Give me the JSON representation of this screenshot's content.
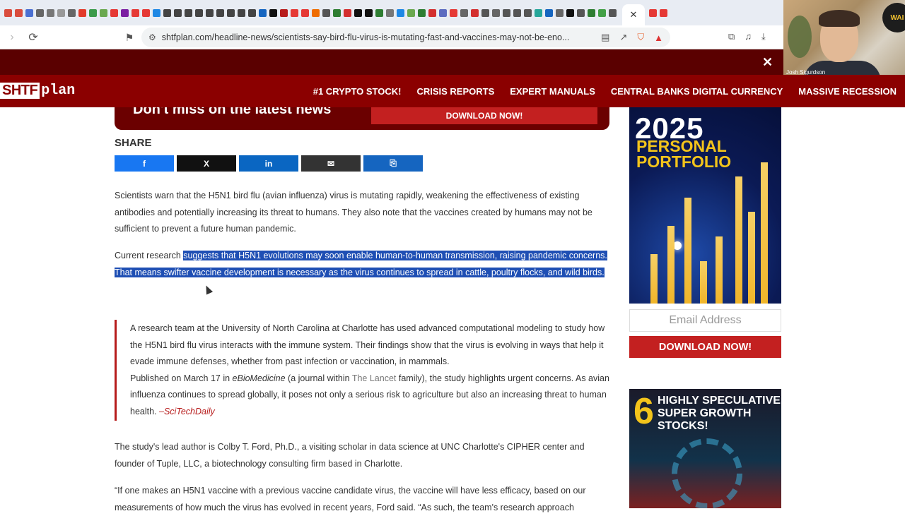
{
  "browser": {
    "url": "shtfplan.com/headline-news/scientists-say-bird-flu-virus-is-mutating-fast-and-vaccines-may-not-be-eno...",
    "tab_favicon_colors": [
      "#d94c3d",
      "#d94c3d",
      "#4a6fd1",
      "#666",
      "#777",
      "#999",
      "#666",
      "#e23b2a",
      "#3b9b4a",
      "#6aa84f",
      "#e53935",
      "#7b1fa2",
      "#e53935",
      "#e53935",
      "#1e88e5",
      "#444",
      "#444",
      "#444",
      "#444",
      "#444",
      "#444",
      "#444",
      "#444",
      "#444",
      "#1565c0",
      "#111",
      "#b71c1c",
      "#e53935",
      "#e53935",
      "#ef6c00",
      "#555",
      "#2e7d32",
      "#d32f2f",
      "#111",
      "#111",
      "#2e7d32",
      "#777",
      "#1e88e5",
      "#6aa84f",
      "#2e7d32",
      "#d32f2f",
      "#5c6bc0",
      "#e53935",
      "#666",
      "#d32f2f",
      "#555",
      "#666",
      "#555",
      "#555",
      "#555",
      "#26a69a",
      "#1565c0",
      "#666",
      "#111",
      "#555",
      "#2e7d32",
      "#43a047",
      "#555",
      "#e53935",
      "#e53935"
    ]
  },
  "webcam": {
    "name": "Josh Sigurdson",
    "logo_text": "WAI"
  },
  "site": {
    "logo_shtf": "SHTF",
    "logo_plan": "plan",
    "nav": [
      "#1 CRYPTO STOCK!",
      "CRISIS REPORTS",
      "EXPERT MANUALS",
      "CENTRAL BANKS DIGITAL CURRENCY",
      "MASSIVE RECESSION"
    ]
  },
  "banner": {
    "text": "Don't miss on the latest news",
    "button": "DOWNLOAD NOW!"
  },
  "share": {
    "label": "SHARE",
    "buttons": [
      {
        "name": "facebook",
        "glyph": "f",
        "color": "#1877f2"
      },
      {
        "name": "x",
        "glyph": "X",
        "color": "#111111"
      },
      {
        "name": "linkedin",
        "glyph": "in",
        "color": "#0a66c2"
      },
      {
        "name": "email",
        "glyph": "✉",
        "color": "#333333"
      },
      {
        "name": "copy-link",
        "glyph": "⎘",
        "color": "#1565c0"
      }
    ]
  },
  "article": {
    "p1": "Scientists warn that the H5N1 bird flu (avian influenza) virus is mutating rapidly, weakening the effectiveness of existing antibodies and potentially increasing its threat to humans.  They also note that the vaccines created by humans may not be sufficient to prevent a future human pandemic.",
    "p2_pre": "Current research ",
    "p2_hl": "suggests that H5N1 evolutions may soon enable human-to-human transmission, raising pandemic concerns. That means swifter vaccine development is necessary as the virus continues to spread in cattle, poultry flocks, and wild birds.",
    "quote_1": "A research team at the University of North Carolina at Charlotte has used advanced computational modeling to study how the H5N1 bird flu virus interacts with the immune system. Their findings show that the virus is evolving in ways that help it evade immune defenses, whether from past infection or vaccination, in mammals.",
    "quote_2a": "Published on March 17 in ",
    "quote_2_journal": "eBioMedicine",
    "quote_2b": " (a journal within ",
    "quote_2_lancet": "The Lancet",
    "quote_2c": " family), the study highlights urgent concerns. As avian influenza continues to spread globally, it poses not only a serious risk to agriculture but also an increasing threat to human health. ",
    "quote_source": "–SciTechDaily",
    "p3": "The study's lead author is Colby T. Ford, Ph.D., a visiting scholar in data science at UNC Charlotte's CIPHER center and founder of Tuple, LLC, a biotechnology consulting firm based in Charlotte.",
    "p4": "“If one makes an H5N1 vaccine with a previous vaccine candidate virus, the vaccine will have less efficacy, based on our measurements of how much the virus has evolved in recent years, Ford said. “As such, the team's research approach"
  },
  "sidebar": {
    "ad1_year": "2025",
    "ad1_line1": "PERSONAL",
    "ad1_line2": "PORTFOLIO",
    "email_placeholder": "Email Address",
    "download": "DOWNLOAD NOW!",
    "ad2_num": "6",
    "ad2_line1": "HIGHLY SPECULATIVE",
    "ad2_line2": "SUPER GROWTH STOCKS!"
  }
}
